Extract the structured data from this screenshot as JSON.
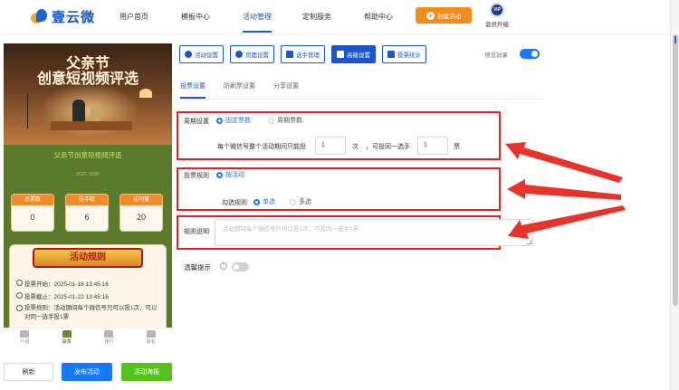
{
  "brand": {
    "name": "壹云微"
  },
  "nav": {
    "items": [
      "用户首页",
      "模板中心",
      "活动管理",
      "定制服务",
      "帮助中心"
    ],
    "active_index": 2,
    "create_label": "创建活动",
    "vip_badge": "VIP",
    "vip_label": "会员升级"
  },
  "preview": {
    "banner_line1": "父亲节",
    "banner_line2": "创意短视频评选",
    "subtitle": "父亲节创意短视频评选",
    "date": "2025 0000",
    "stats": [
      {
        "label": "总票数",
        "value": "0"
      },
      {
        "label": "选手数",
        "value": "6"
      },
      {
        "label": "访问量",
        "value": "20"
      }
    ],
    "rules_title": "活动规则",
    "rules": [
      "投票开始：2025-01-16 13:45:16",
      "投票截止：2025-01-22 13:45:16",
      "投票规则：活动期间每个微信号只可以投1次，可以对同一选手投1票"
    ],
    "tabs": [
      "介绍",
      "投票",
      "排行",
      "报名"
    ],
    "active_tab": 1
  },
  "buttons": {
    "refresh": "刷新",
    "publish": "发布活动",
    "poster": "活动海报"
  },
  "toolbar": {
    "items": [
      "活动设置",
      "页面设置",
      "选手管理",
      "高级设置",
      "投票统计"
    ],
    "active_index": 3,
    "preview_label": "预览效果"
  },
  "subtabs": {
    "items": [
      "投票设置",
      "防刷票设置",
      "分享设置"
    ],
    "active_index": 0
  },
  "form": {
    "cycle_label": "周期设置",
    "cycle_fixed": "固定票数",
    "cycle_periodic": "周期票数",
    "rule_text_a": "每个微信号整个活动期间只能投",
    "votes_value": "1",
    "rule_text_b": "次",
    "rule_text_c": "，可投同一选手",
    "same_value": "1",
    "rule_text_d": "票",
    "vote_rule_label": "投票规则",
    "vote_rule_option": "按活动",
    "check_rule_label": "勾选规则",
    "single": "单选",
    "multi": "多选",
    "rule_desc_label": "规则说明",
    "rule_desc_placeholder": "活动期间每个微信号只可以投1次，可投同一选手1票",
    "tip_label": "温馨提示",
    "help_glyph": "?"
  },
  "colors": {
    "accent": "#1a56c8",
    "orange": "#f28c1a",
    "highlight": "#e02222",
    "green": "#52c41a"
  }
}
